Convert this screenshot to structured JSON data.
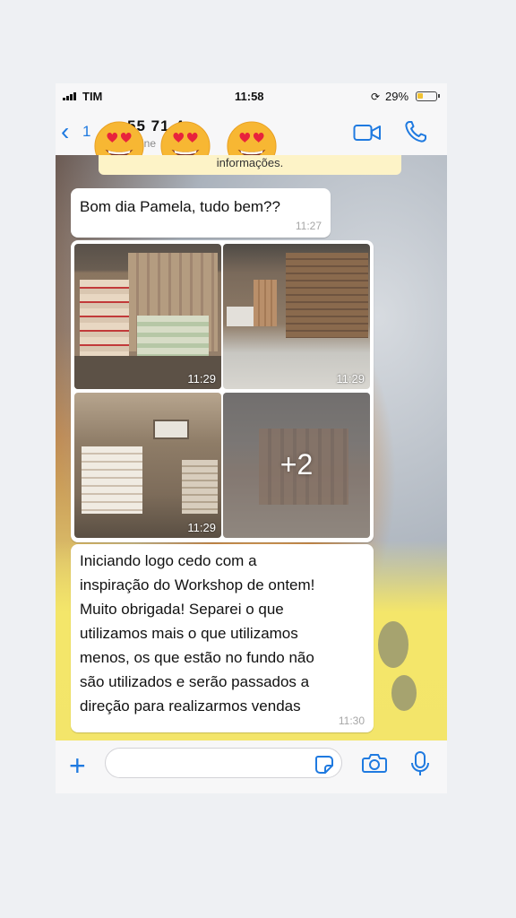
{
  "status_bar": {
    "carrier": "TIM",
    "time": "11:58",
    "battery_percent": "29%",
    "battery_level": 0.29,
    "battery_color": "#f1c232"
  },
  "header": {
    "back_count": "1",
    "contact_name": "55      71      4",
    "contact_status": "online",
    "back_icon": "chevron-left-icon",
    "video_icon": "video-camera-icon",
    "call_icon": "phone-icon",
    "accent": "#1f7ae0"
  },
  "overlay_emojis": [
    "heart-eyes-emoji",
    "heart-eyes-emoji",
    "heart-eyes-emoji"
  ],
  "chat": {
    "banner_text": "informações.",
    "messages": [
      {
        "text": "Bom dia Pamela, tudo bem??",
        "time": "11:27"
      },
      {
        "type": "album",
        "photos": [
          {
            "time": "11:29"
          },
          {
            "time": "11:29"
          },
          {
            "time": "11:29"
          },
          {
            "more": "+2"
          }
        ]
      },
      {
        "lines": [
          "Iniciando logo cedo com a",
          "inspiração do Workshop de ontem!",
          "Muito obrigada! Separei o que",
          "utilizamos mais o que utilizamos",
          "menos, os que estão no fundo não",
          "são utilizados e serão passados a",
          "direção para realizarmos vendas"
        ],
        "time": "11:30"
      }
    ]
  },
  "input_bar": {
    "add_icon": "plus-icon",
    "placeholder": "",
    "sticker_icon": "sticker-icon",
    "camera_icon": "camera-icon",
    "mic_icon": "microphone-icon"
  }
}
